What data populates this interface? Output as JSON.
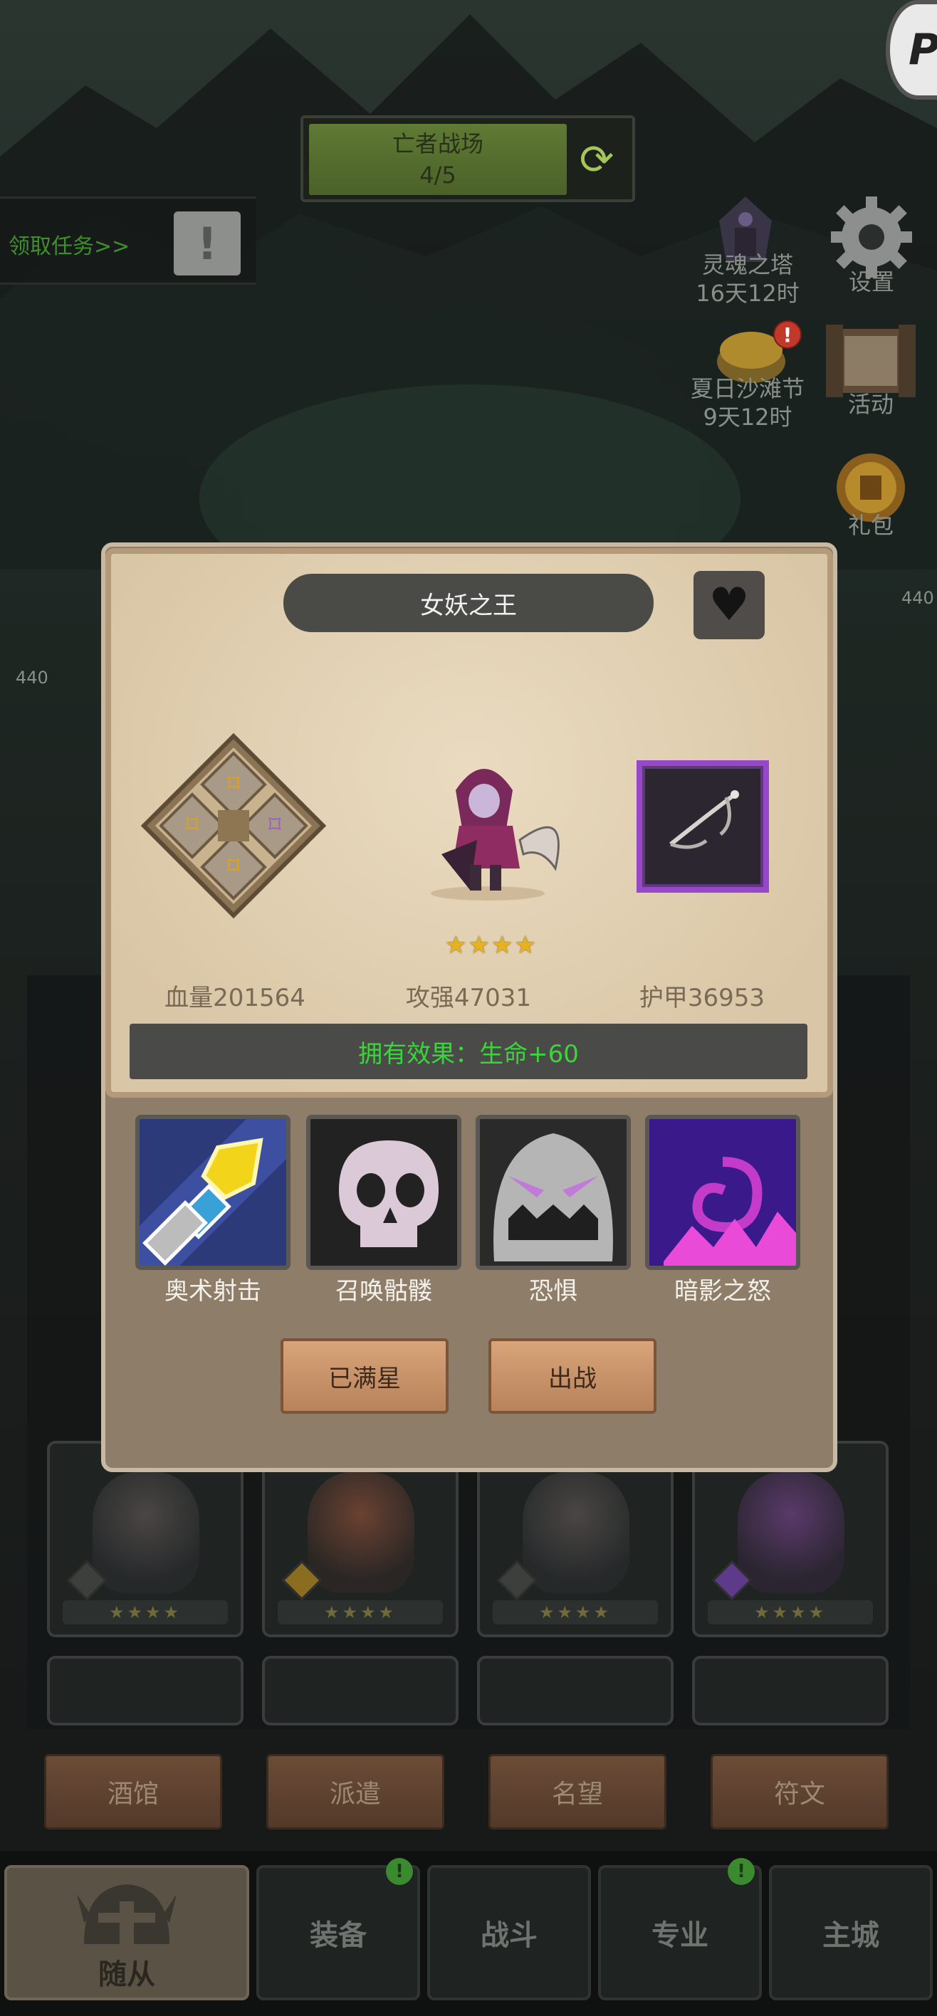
{
  "banner": {
    "title": "亡者战场",
    "progress": "4/5"
  },
  "quest": {
    "label": "领取任务>>"
  },
  "corner": {
    "letter": "P"
  },
  "side_menu": [
    {
      "label": "灵魂之塔",
      "sub": "16天12时"
    },
    {
      "label": "设置"
    },
    {
      "label": "夏日沙滩节",
      "sub": "9天12时"
    },
    {
      "label": "活动"
    },
    {
      "label": "礼包"
    }
  ],
  "bg_levels": [
    "440",
    "440"
  ],
  "dialog": {
    "hero_name": "女妖之王",
    "star_count": 4,
    "stats": {
      "hp": "血量201564",
      "atk": "攻强47031",
      "armor": "护甲36953"
    },
    "effect": "拥有效果：生命+60",
    "skills": [
      "奥术射击",
      "召唤骷髅",
      "恐惧",
      "暗影之怒"
    ],
    "buttons": {
      "maxed": "已满星",
      "deploy": "出战"
    }
  },
  "tabs": [
    "酒馆",
    "派遣",
    "名望",
    "符文"
  ],
  "nav": [
    "随从",
    "装备",
    "战斗",
    "专业",
    "主城"
  ],
  "colors": {
    "effect_text": "#3ad53a",
    "star": "#e7b21f",
    "epic_frame": "#9747c9"
  }
}
